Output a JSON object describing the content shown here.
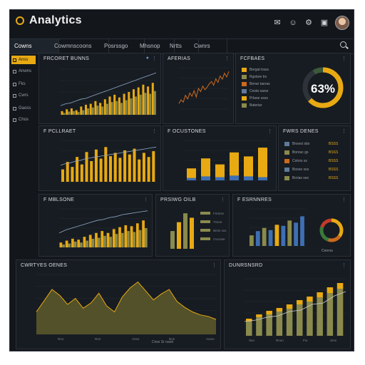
{
  "app": {
    "title": "Analytics"
  },
  "titlebar": {
    "icons": [
      "bell-icon",
      "user-icon",
      "settings-icon",
      "share-icon"
    ]
  },
  "tabs": [
    {
      "label": "Cowns",
      "active": true
    },
    {
      "label": "Cowmnscoons",
      "active": false
    },
    {
      "label": "Posrssgo",
      "active": false
    },
    {
      "label": "Mhsnop",
      "active": false
    },
    {
      "label": "Nrtts",
      "active": false
    },
    {
      "label": "Cwnrs",
      "active": false
    }
  ],
  "sidebar": {
    "items": [
      {
        "label": "Anss",
        "active": true
      },
      {
        "label": "Anwns",
        "active": false
      },
      {
        "label": "Fks",
        "active": false
      },
      {
        "label": "Cwrs",
        "active": false
      },
      {
        "label": "Gaoss",
        "active": false
      },
      {
        "label": "Chos",
        "active": false
      }
    ]
  },
  "colors": {
    "accent": "#e8a913",
    "olive": "#8a8a4c",
    "blue": "#3f6fb3",
    "line": "#cc6a1c",
    "panel": "#171c22",
    "bg": "#13171c"
  },
  "panels": {
    "p1": {
      "title": "FRCORET BUNNS",
      "chart_data": {
        "type": "bar",
        "series": [
          {
            "values": [
              8,
              12,
              14,
              10,
              18,
              22,
              24,
              30,
              26,
              34,
              40,
              44,
              38,
              46,
              50,
              56,
              60,
              66,
              62,
              70
            ]
          },
          {
            "values": [
              4,
              7,
              8,
              6,
              10,
              14,
              16,
              20,
              18,
              24,
              28,
              30,
              26,
              32,
              36,
              40,
              44,
              48,
              46,
              52
            ]
          }
        ],
        "line": [
          20,
          24,
          26,
          30,
          34,
          36,
          40,
          44,
          48,
          52,
          56,
          60,
          64,
          68,
          72,
          76,
          80,
          84,
          88,
          92
        ]
      }
    },
    "p2": {
      "title": "AFERIAS",
      "chart_data": {
        "type": "line",
        "values": [
          12,
          20,
          15,
          30,
          22,
          35,
          28,
          40,
          26,
          45,
          38,
          50,
          42,
          48,
          55,
          60,
          52,
          66,
          58,
          72,
          65,
          78,
          70,
          82
        ]
      }
    },
    "p3": {
      "title": "FCFBAES",
      "legend": [
        {
          "label": "Bergat trass",
          "color": "#e8a913"
        },
        {
          "label": "Rgslare trs",
          "color": "#8a8a4c"
        },
        {
          "label": "Benar taeras",
          "color": "#cc6a1c"
        },
        {
          "label": "Cesta sarss",
          "color": "#5d7a9a"
        },
        {
          "label": "Prlaoe ssss",
          "color": "#e8a913"
        },
        {
          "label": "Bateriar",
          "color": "#8a8a4c"
        }
      ],
      "donut": {
        "label": "63%",
        "value": 63
      }
    },
    "p4": {
      "title": "F PCLLRAET",
      "chart_data": {
        "type": "bar",
        "values": [
          30,
          48,
          36,
          60,
          42,
          72,
          50,
          78,
          56,
          84,
          62,
          70,
          58,
          76,
          66,
          80,
          54,
          70,
          60,
          74
        ],
        "line": [
          40,
          44,
          46,
          50,
          52,
          56,
          58,
          60,
          62,
          64,
          66,
          68,
          70,
          72,
          74,
          76,
          78,
          80,
          82,
          84
        ]
      }
    },
    "p5": {
      "title": "F OCUSTONES",
      "chart_data": {
        "type": "bar",
        "values": [
          30,
          55,
          40,
          70,
          60,
          82
        ],
        "blue_values": [
          6,
          10,
          8,
          12,
          10,
          8
        ]
      }
    },
    "p6": {
      "title": "FWRS DENES",
      "rows": [
        {
          "label": "Bnsesi sbo",
          "value": "BSSS"
        },
        {
          "label": "Bonrac gs",
          "value": "BSSS"
        },
        {
          "label": "Cotrss ss",
          "value": "BSSS"
        },
        {
          "label": "Bosoe sss",
          "value": "BSSS"
        },
        {
          "label": "Bcrias ses",
          "value": "BSSS"
        }
      ]
    },
    "p7": {
      "title": "F MBLSONE",
      "chart_data": {
        "type": "bar",
        "series": [
          {
            "values": [
              10,
              14,
              18,
              16,
              22,
              26,
              30,
              34,
              30,
              38,
              42,
              46,
              44,
              50,
              56
            ]
          },
          {
            "values": [
              6,
              8,
              12,
              10,
              14,
              18,
              20,
              24,
              22,
              28,
              30,
              34,
              32,
              36,
              40
            ]
          }
        ],
        "line": [
          30,
          36,
          40,
          44,
          48,
          52,
          56,
          58,
          62,
          64,
          68,
          70,
          72,
          74,
          76
        ]
      }
    },
    "p8": {
      "title": "PRSIWG OILB",
      "chart_data": {
        "type": "bar",
        "values": [
          40,
          60,
          80,
          70
        ],
        "legend": [
          "Fnrtsse",
          "Tnsrsr",
          "Bnrts sss",
          "Cvrosse"
        ]
      }
    },
    "p9": {
      "title": "F ESRNNRES",
      "chart_data": {
        "type": "bar",
        "values": [
          20,
          28,
          34,
          30,
          40,
          38,
          48,
          44,
          56
        ],
        "colors": [
          "#8a8a4c",
          "#3f6fb3",
          "#8a8a4c",
          "#3f6fb3",
          "#e8a913",
          "#3f6fb3",
          "#8a8a4c",
          "#3f6fb3",
          "#3f6fb3"
        ]
      },
      "donut_label": "Cenrss"
    },
    "p10": {
      "title": "CWRTYES OENES",
      "chart_data": {
        "type": "area",
        "values": [
          30,
          45,
          60,
          52,
          40,
          48,
          35,
          42,
          55,
          38,
          30,
          50,
          62,
          70,
          58,
          46,
          54,
          60,
          44,
          36,
          30,
          26,
          24,
          20
        ]
      },
      "x_labels": [
        "Nno",
        "Ros",
        "Anso",
        "Ros",
        "Aorso"
      ],
      "footnote": "Cnss Sr oaon"
    },
    "p11": {
      "title": "DUNRSNSRD",
      "chart_data": {
        "type": "bar",
        "values": [
          20,
          26,
          30,
          34,
          38,
          44,
          48,
          54,
          60,
          66
        ],
        "caps": [
          4,
          4,
          5,
          5,
          6,
          6,
          7,
          7,
          8,
          8
        ],
        "line": [
          20,
          22,
          26,
          28,
          34,
          36,
          44,
          46,
          56,
          62
        ]
      },
      "x_labels": [
        "Sen",
        "Rnon",
        "Fto",
        "Smn"
      ]
    }
  }
}
